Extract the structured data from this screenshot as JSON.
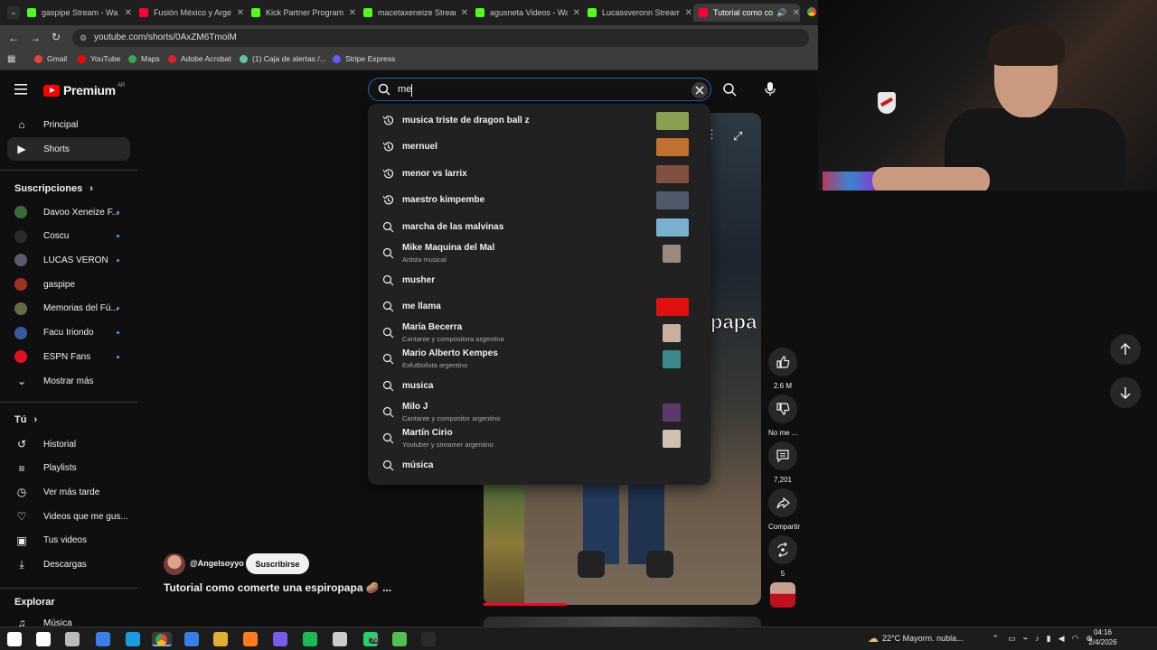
{
  "browser": {
    "tabs": [
      {
        "title": "gaspipe Stream - Wa",
        "color": "#53fc18"
      },
      {
        "title": "Fusión México y Arge",
        "color": "#ff0033"
      },
      {
        "title": "Kick Partner Program",
        "color": "#53fc18"
      },
      {
        "title": "macetaxeneize Stream",
        "color": "#53fc18"
      },
      {
        "title": "agusneta Videos - Wa",
        "color": "#53fc18"
      },
      {
        "title": "Lucassveronn Stream",
        "color": "#53fc18"
      },
      {
        "title": "Tutorial como co",
        "color": "#ff0033"
      }
    ],
    "url": "youtube.com/shorts/0AxZM6TmoiM",
    "bookmarks": [
      {
        "label": "Gmail",
        "color": "#ea4335"
      },
      {
        "label": "YouTube",
        "color": "#ff0000"
      },
      {
        "label": "Maps",
        "color": "#34a853"
      },
      {
        "label": "Adobe Acrobat",
        "color": "#e0201a"
      },
      {
        "label": "(1) Caja de alertas /...",
        "color": "#5bc8a4"
      },
      {
        "label": "Stripe Express",
        "color": "#635bff"
      }
    ]
  },
  "header": {
    "logo_text": "Premium",
    "country": "AR",
    "search_value": "me"
  },
  "sidebar": {
    "main": [
      {
        "label": "Principal",
        "icon": "home-icon"
      },
      {
        "label": "Shorts",
        "icon": "shorts-icon"
      }
    ],
    "subs_heading": "Suscripciones",
    "subscriptions": [
      {
        "label": "Davoo Xeneize F...",
        "color": "#3a6a3a"
      },
      {
        "label": "Coscu",
        "color": "#2a2a2a"
      },
      {
        "label": "LUCAS VERON",
        "color": "#5a5a6a"
      },
      {
        "label": "gaspipe",
        "color": "#a03020"
      },
      {
        "label": "Memorias del Fú...",
        "color": "#6a6a4a"
      },
      {
        "label": "Facu Iriondo",
        "color": "#3a5aa0"
      },
      {
        "label": "ESPN Fans",
        "color": "#e01020"
      }
    ],
    "show_more": "Mostrar más",
    "you_heading": "Tú",
    "you_items": [
      {
        "label": "Historial",
        "icon": "history-icon"
      },
      {
        "label": "Playlists",
        "icon": "playlists-icon"
      },
      {
        "label": "Ver más tarde",
        "icon": "watch-later-icon"
      },
      {
        "label": "Videos que me gus...",
        "icon": "like-icon"
      },
      {
        "label": "Tus videos",
        "icon": "your-videos-icon"
      },
      {
        "label": "Descargas",
        "icon": "download-icon"
      }
    ],
    "explore_heading": "Explorar",
    "explore_items": [
      {
        "label": "Música",
        "icon": "music-icon"
      }
    ]
  },
  "suggestions": [
    {
      "text": "musica triste de dragon ball z",
      "sub": "",
      "type": "history",
      "thumb": "wide",
      "thumb_color": "#8aa050"
    },
    {
      "text": "mernuel",
      "sub": "",
      "type": "history",
      "thumb": "wide",
      "thumb_color": "#c07030"
    },
    {
      "text": "menor vs larrix",
      "sub": "",
      "type": "history",
      "thumb": "wide",
      "thumb_color": "#805040"
    },
    {
      "text": "maestro kimpembe",
      "sub": "",
      "type": "history",
      "thumb": "wide",
      "thumb_color": "#505a6a"
    },
    {
      "text": "marcha de las malvinas",
      "sub": "",
      "type": "search",
      "thumb": "wide",
      "thumb_color": "#7ab0d0"
    },
    {
      "text": "Mike Maquina del Mal",
      "sub": "Artista musical",
      "type": "search",
      "thumb": "square",
      "thumb_color": "#9a8a80"
    },
    {
      "text": "musher",
      "sub": "",
      "type": "search",
      "thumb": "none",
      "thumb_color": ""
    },
    {
      "text": "me llama",
      "sub": "",
      "type": "search",
      "thumb": "wide",
      "thumb_color": "#e01010"
    },
    {
      "text": "María Becerra",
      "sub": "Cantante y compositora argentina",
      "type": "search",
      "thumb": "square",
      "thumb_color": "#c8b0a0"
    },
    {
      "text": "Mario Alberto Kempes",
      "sub": "Exfutbolista argentino",
      "type": "search",
      "thumb": "square",
      "thumb_color": "#3a8a8a"
    },
    {
      "text": "musica",
      "sub": "",
      "type": "search",
      "thumb": "none",
      "thumb_color": ""
    },
    {
      "text": "Milo J",
      "sub": "Cantante y compositor argentino",
      "type": "search",
      "thumb": "square",
      "thumb_color": "#5a3a6a"
    },
    {
      "text": "Martín Cirio",
      "sub": "Youtuber y streamer argentino",
      "type": "search",
      "thumb": "square",
      "thumb_color": "#d0c0b0"
    },
    {
      "text": "música",
      "sub": "",
      "type": "search",
      "thumb": "none",
      "thumb_color": ""
    }
  ],
  "video": {
    "caption_word": "papa",
    "channel": "@Angelsoyyo",
    "subscribe": "Suscribirse",
    "title": "Tutorial como comerte una espiropapa 🥔 ..."
  },
  "actions": {
    "likes": "2.6 M",
    "dislike": "No me ...",
    "comments": "7,201",
    "share": "Compartir",
    "remix": "5"
  },
  "taskbar": {
    "weather": "22°C  Mayorm. nubla...",
    "time": "04:16",
    "date": "2/4/2026",
    "whatsapp_badge": "70"
  }
}
